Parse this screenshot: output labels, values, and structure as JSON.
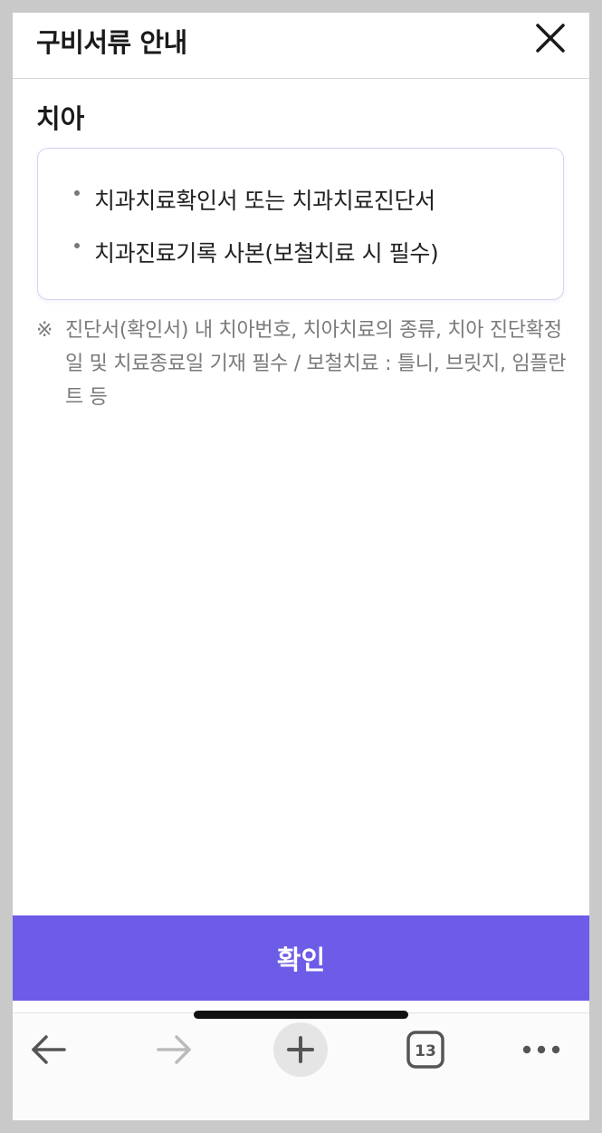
{
  "header": {
    "title": "구비서류 안내",
    "close_icon": "close-icon"
  },
  "section": {
    "title": "치아",
    "documents": [
      "치과치료확인서 또는 치과치료진단서",
      "치과진료기록 사본(보철치료 시 필수)"
    ]
  },
  "note": {
    "mark": "※",
    "text": "진단서(확인서) 내 치아번호, 치아치료의 종류, 치아 진단확정일 및 치료종료일 기재 필수 / 보철치료 : 틀니, 브릿지, 임플란트 등"
  },
  "footer": {
    "confirm_label": "확인"
  },
  "browser_bar": {
    "tab_count": "13",
    "icons": [
      "back-arrow-icon",
      "forward-arrow-icon",
      "plus-icon",
      "tabs-icon",
      "more-icon"
    ]
  },
  "colors": {
    "accent": "#6d5ce8",
    "box_border": "#d6d3f2",
    "note_text": "#7a7a7a"
  }
}
